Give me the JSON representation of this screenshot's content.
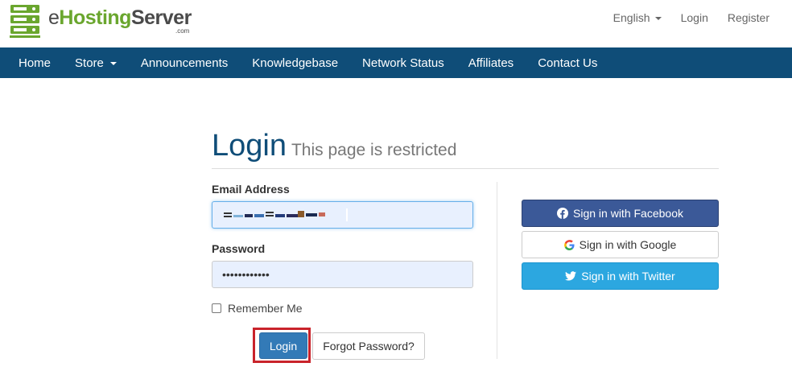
{
  "brand": {
    "logo_prefix": "e",
    "logo_hosting": "Hosting",
    "logo_server": "Server",
    "logo_suffix": ".com"
  },
  "top_links": {
    "language": "English",
    "login": "Login",
    "register": "Register"
  },
  "nav": {
    "items": [
      "Home",
      "Store",
      "Announcements",
      "Knowledgebase",
      "Network Status",
      "Affiliates",
      "Contact Us"
    ]
  },
  "login_page": {
    "title": "Login",
    "subtitle": "This page is restricted",
    "email_label": "Email Address",
    "password_label": "Password",
    "password_value": "••••••••••••",
    "remember_label": "Remember Me",
    "login_button": "Login",
    "forgot_button": "Forgot Password?"
  },
  "social": {
    "facebook": "Sign in with Facebook",
    "google": "Sign in with Google",
    "twitter": "Sign in with Twitter"
  },
  "colors": {
    "nav_bg": "#0f4d78",
    "brand_green": "#6aa62e",
    "primary": "#337ab7",
    "facebook": "#3b5998",
    "twitter": "#2ca7e0",
    "highlight": "#c9232b"
  }
}
